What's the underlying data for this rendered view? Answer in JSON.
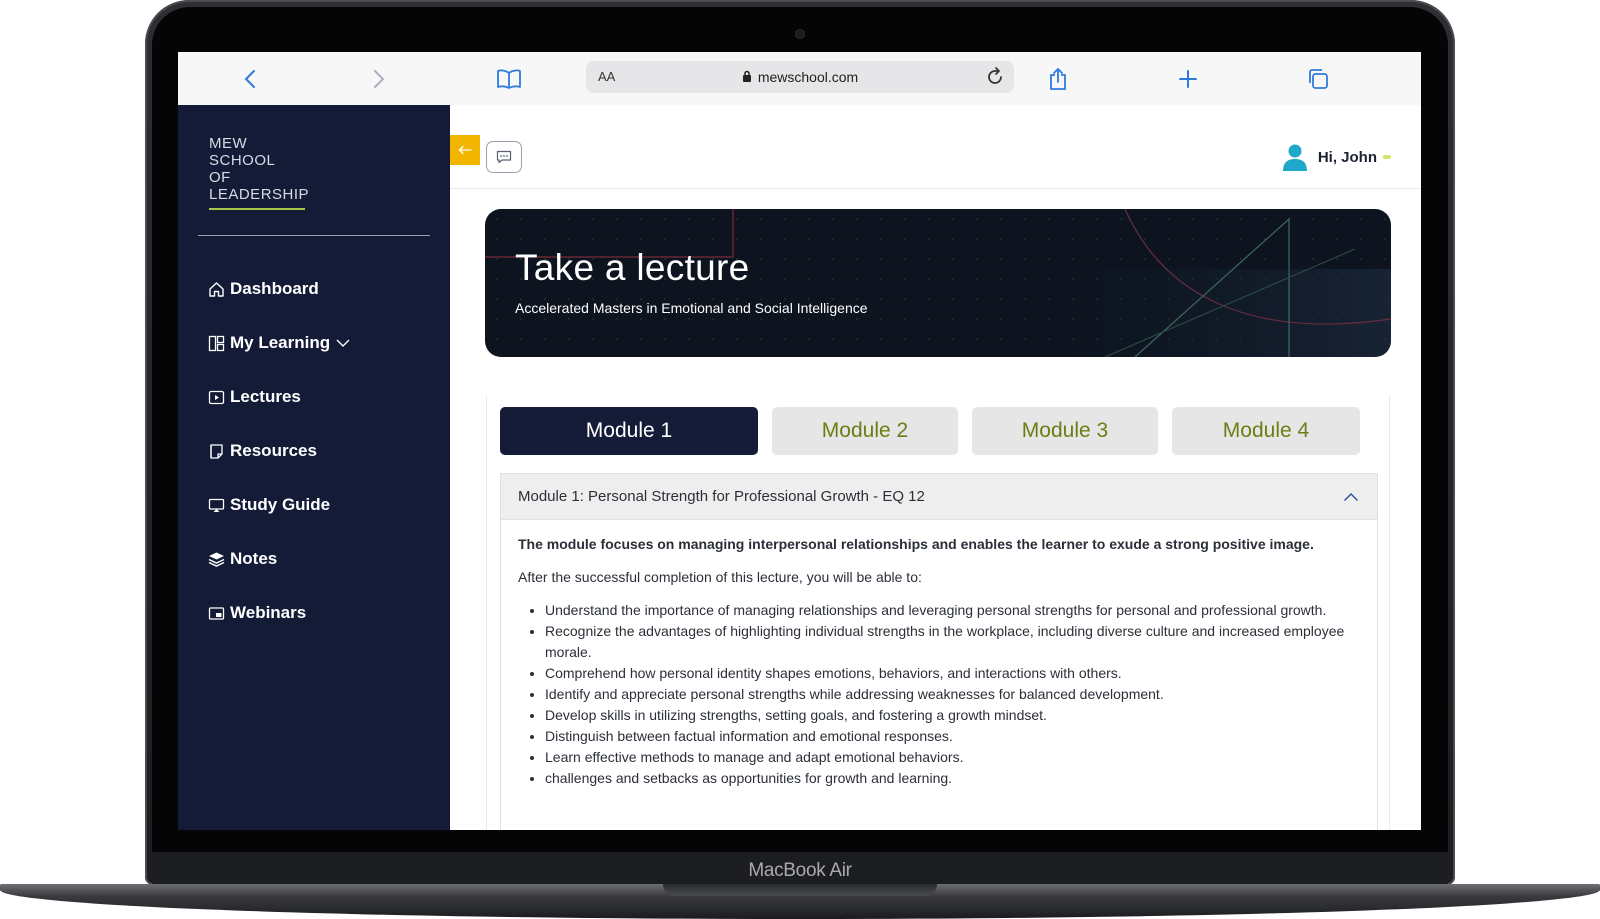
{
  "device": {
    "label": "MacBook Air"
  },
  "browser": {
    "text_size_label": "AA",
    "url": "mewschool.com",
    "icons": [
      "back-icon",
      "forward-icon",
      "bookmarks-icon",
      "lock-icon",
      "reload-icon",
      "share-icon",
      "new-tab-icon",
      "tabs-icon"
    ]
  },
  "sidebar": {
    "logo_lines": [
      "MEW",
      "SCHOOL",
      "OF",
      "LEADERSHIP"
    ],
    "accent_color": "#a7c64a",
    "items": [
      {
        "label": "Dashboard",
        "icon": "home-icon"
      },
      {
        "label": "My Learning",
        "icon": "layout-icon",
        "has_dropdown": true
      },
      {
        "label": "Lectures",
        "icon": "play-icon"
      },
      {
        "label": "Resources",
        "icon": "document-icon"
      },
      {
        "label": "Study Guide",
        "icon": "monitor-icon"
      },
      {
        "label": "Notes",
        "icon": "layers-icon"
      },
      {
        "label": "Webinars",
        "icon": "webinar-icon"
      }
    ]
  },
  "topbar": {
    "collapse_icon": "arrow-left-icon",
    "chat_icon": "chat-icon",
    "user_greeting": "Hi, John",
    "status_color": "#cfe86a"
  },
  "hero": {
    "title": "Take a lecture",
    "subtitle": "Accelerated Masters in Emotional and Social Intelligence"
  },
  "modules": {
    "tabs": [
      {
        "label": "Module 1",
        "active": true
      },
      {
        "label": "Module 2",
        "active": false
      },
      {
        "label": "Module 3",
        "active": false
      },
      {
        "label": "Module 4",
        "active": false
      }
    ],
    "active_color": "#141c38",
    "inactive_text_color": "#6d7d14"
  },
  "accordion": {
    "title": "Module 1: Personal Strength for Professional Growth - EQ 12",
    "expanded": true,
    "lead": "The module focuses on managing interpersonal relationships and enables the learner to exude a strong positive image.",
    "intro": "After the successful completion of this lecture, you will be able to:",
    "objectives": [
      "Understand the importance of managing relationships and leveraging personal strengths for personal and professional growth.",
      "Recognize the advantages of highlighting individual strengths in the workplace, including diverse culture and increased employee morale.",
      "Comprehend how personal identity shapes emotions, behaviors, and interactions with others.",
      "Identify and appreciate personal strengths while addressing weaknesses for balanced development.",
      "Develop skills in utilizing strengths, setting goals, and fostering a growth mindset.",
      "Distinguish between factual information and emotional responses.",
      "Learn effective methods to manage and adapt emotional behaviors.",
      "challenges and setbacks as opportunities for growth and learning."
    ]
  }
}
